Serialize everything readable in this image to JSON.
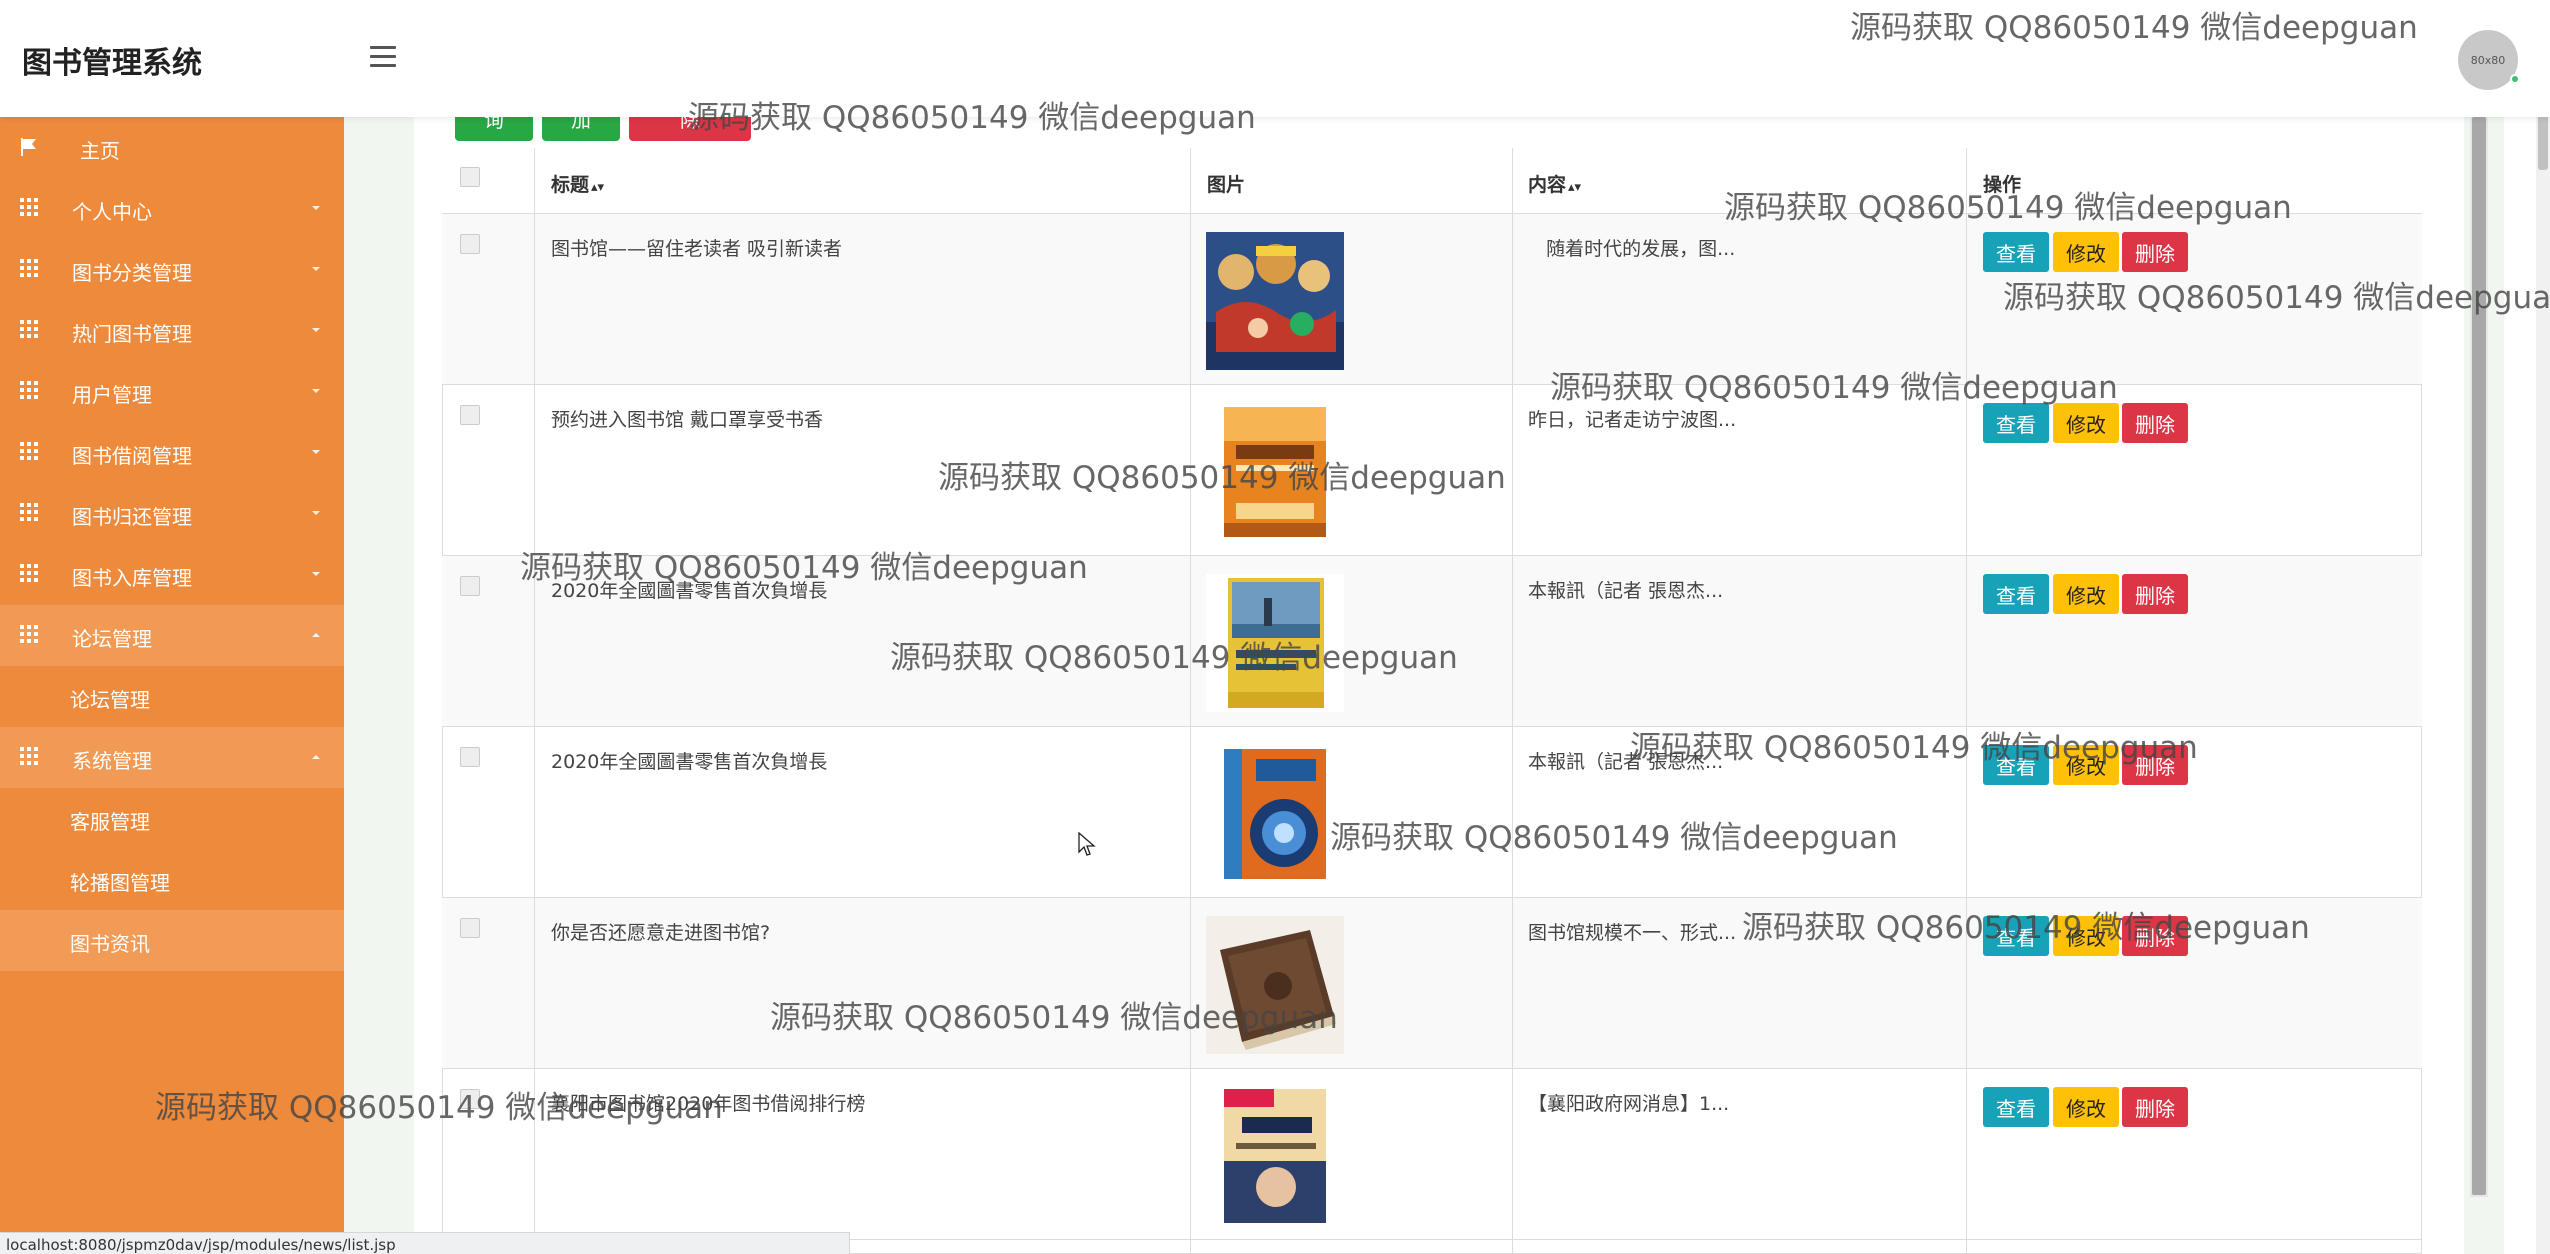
{
  "header": {
    "app_title": "图书管理系统",
    "avatar_text": "80x80"
  },
  "sidebar": {
    "items": [
      {
        "label": "主页",
        "icon": "flag-icon"
      },
      {
        "label": "个人中心",
        "icon": "grid-icon"
      },
      {
        "label": "图书分类管理",
        "icon": "grid-icon"
      },
      {
        "label": "热门图书管理",
        "icon": "grid-icon"
      },
      {
        "label": "用户管理",
        "icon": "grid-icon"
      },
      {
        "label": "图书借阅管理",
        "icon": "grid-icon"
      },
      {
        "label": "图书归还管理",
        "icon": "grid-icon"
      },
      {
        "label": "图书入库管理",
        "icon": "grid-icon"
      },
      {
        "label": "论坛管理",
        "icon": "grid-icon",
        "expanded": true
      },
      {
        "label": "论坛管理",
        "sub": true
      },
      {
        "label": "系统管理",
        "icon": "grid-icon",
        "expanded": true
      },
      {
        "label": "客服管理",
        "sub": true
      },
      {
        "label": "轮播图管理",
        "sub": true
      },
      {
        "label": "图书资讯",
        "sub": true,
        "selected": true
      }
    ]
  },
  "toolbar": {
    "query_label": "查询",
    "add_label": "添加",
    "batch_delete_label": "批量删除"
  },
  "table": {
    "headers": {
      "title": "标题",
      "image": "图片",
      "content": "内容",
      "actions": "操作"
    },
    "rows": [
      {
        "title": "图书馆——留住老读者 吸引新读者",
        "content": "随着时代的发展，图...",
        "image": "colorful-anime-cover"
      },
      {
        "title": "预约进入图书馆 戴口罩享受书香",
        "content": "昨日，记者走访宁波图...",
        "image": "super-memory-book-cover"
      },
      {
        "title": "2020年全國圖書零售首次負增長",
        "content": "本報訊（記者 張恩杰...",
        "image": "yellow-blue-book-cover"
      },
      {
        "title": "2020年全國圖書零售首次負增長",
        "content": "本報訊（記者 張恩杰...",
        "image": "brain-memory-book-cover"
      },
      {
        "title": "你是否还愿意走进图书馆?",
        "content": "图书馆规模不一、形式...",
        "image": "old-leather-book"
      },
      {
        "title": "襄阳市图书馆2020年图书借阅排行榜",
        "content": "【襄阳政府网消息】1...",
        "image": "stock-market-book-cover"
      }
    ],
    "view_label": "查看",
    "edit_label": "修改",
    "delete_label": "删除"
  },
  "statusbar": {
    "url": "localhost:8080/jspmz0dav/jsp/modules/news/list.jsp"
  },
  "watermark": {
    "text": "源码获取 QQ86050149 微信deepguan"
  },
  "colors": {
    "sidebar": "#ee8a3c",
    "success": "#28a745",
    "danger": "#dc3545",
    "info": "#17a2b8",
    "warning": "#ffc107"
  }
}
